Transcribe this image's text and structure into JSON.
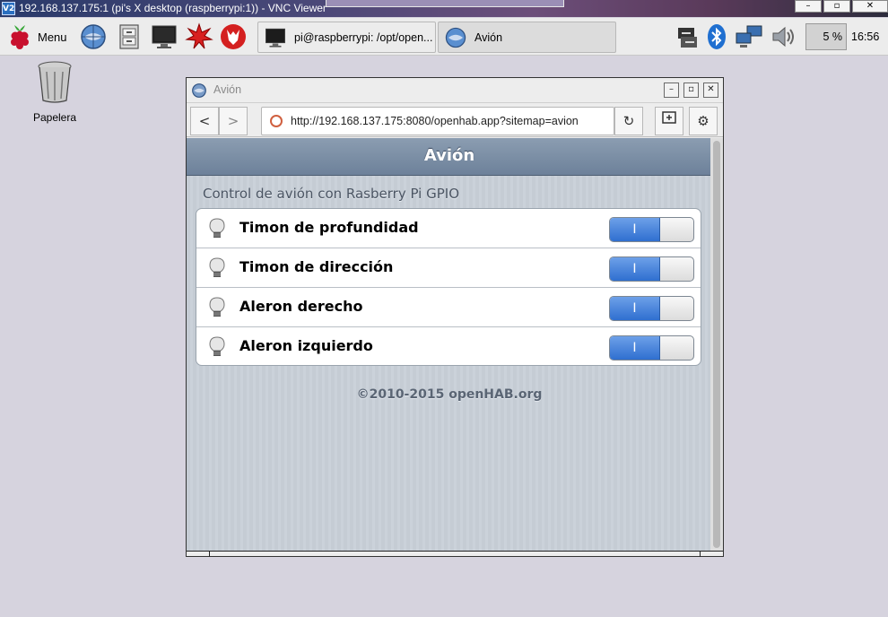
{
  "vnc": {
    "icon_label": "V2",
    "title": "192.168.137.175:1 (pi's X desktop (raspberrypi:1)) - VNC Viewer",
    "controls": [
      "–",
      "▫",
      "✕"
    ]
  },
  "panel": {
    "menu_label": "Menu",
    "tasks": [
      {
        "label": "pi@raspberrypi: /opt/open..."
      },
      {
        "label": "Avión"
      }
    ],
    "cpu_value": "5 %",
    "clock": "16:56"
  },
  "desktop": {
    "trash_label": "Papelera"
  },
  "browser": {
    "window_title": "Avión",
    "window_controls": [
      "–",
      "▫",
      "✕"
    ],
    "back_label": "<",
    "forward_label": ">",
    "url": "http://192.168.137.175:8080/openhab.app?sitemap=avion",
    "reload_label": "↻",
    "settings_label": "⚙"
  },
  "page": {
    "header_title": "Avión",
    "subtitle": "Control de avión con Rasberry Pi GPIO",
    "items": [
      {
        "label": "Timon de profundidad",
        "state": "I"
      },
      {
        "label": "Timon de dirección",
        "state": "I"
      },
      {
        "label": "Aleron derecho",
        "state": "I"
      },
      {
        "label": "Aleron izquierdo",
        "state": "I"
      }
    ],
    "footer": "©2010-2015 openHAB.org"
  },
  "colors": {
    "accent_blue": "#2f6fd0",
    "header_bg": "#6d819a"
  }
}
